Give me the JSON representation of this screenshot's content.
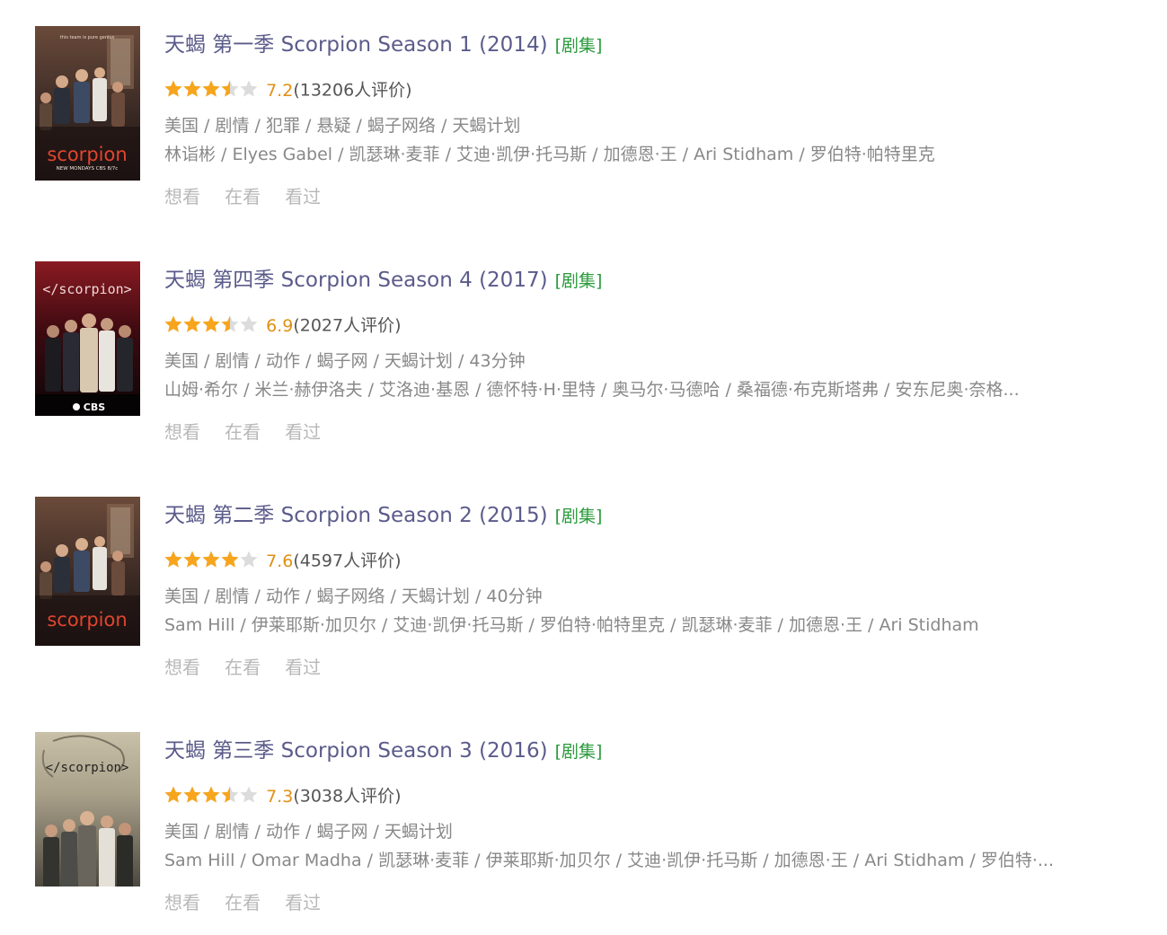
{
  "colors": {
    "title": "#5b5b8b",
    "tag": "#2a9a3b",
    "score": "#e09015",
    "star_on": "#f7a51c",
    "star_off": "#dcdcdc",
    "meta_text": "#888888",
    "action_text": "#b8b8b8"
  },
  "items": [
    {
      "title": "天蝎 第一季 Scorpion Season 1 (2014)",
      "tag": "[剧集]",
      "stars": 3.5,
      "score": "7.2",
      "rating_count": "(13206人评价)",
      "meta": "美国 / 剧情 / 犯罪 / 悬疑 / 蝎子网络 / 天蝎计划",
      "cast": "林诣彬 / Elyes Gabel / 凯瑟琳·麦菲 / 艾迪·凯伊·托马斯 / 加德恩·王 / Ari Stidham / 罗伯特·帕特里克",
      "actions": [
        "想看",
        "在看",
        "看过"
      ],
      "poster": {
        "wordmark": "scorpion",
        "tagline": "this team is pure genius",
        "footer": "NEW MONDAYS CBS 8/7c"
      }
    },
    {
      "title": "天蝎 第四季 Scorpion Season 4 (2017)",
      "tag": "[剧集]",
      "stars": 3.5,
      "score": "6.9",
      "rating_count": "(2027人评价)",
      "meta": "美国 / 剧情 / 动作 / 蝎子网 / 天蝎计划 / 43分钟",
      "cast": "山姆·希尔 / 米兰·赫伊洛夫 / 艾洛迪·基恩 / 德怀特·H·里特 / 奥马尔·马德哈 / 桑福德·布克斯塔弗 / 安东尼奥·奈格...",
      "actions": [
        "想看",
        "在看",
        "看过"
      ],
      "poster": {
        "wordmark": "</scorpion>",
        "footer": "CBS"
      }
    },
    {
      "title": "天蝎 第二季 Scorpion Season 2 (2015)",
      "tag": "[剧集]",
      "stars": 4,
      "score": "7.6",
      "rating_count": "(4597人评价)",
      "meta": "美国 / 剧情 / 动作 / 蝎子网络 / 天蝎计划 / 40分钟",
      "cast": "Sam Hill / 伊莱耶斯·加贝尔 / 艾迪·凯伊·托马斯 / 罗伯特·帕特里克 / 凯瑟琳·麦菲 / 加德恩·王 / Ari Stidham",
      "actions": [
        "想看",
        "在看",
        "看过"
      ],
      "poster": {
        "wordmark": "scorpion"
      }
    },
    {
      "title": "天蝎 第三季 Scorpion Season 3 (2016)",
      "tag": "[剧集]",
      "stars": 3.5,
      "score": "7.3",
      "rating_count": "(3038人评价)",
      "meta": "美国 / 剧情 / 动作 / 蝎子网 / 天蝎计划",
      "cast": "Sam Hill / Omar Madha / 凯瑟琳·麦菲 / 伊莱耶斯·加贝尔 / 艾迪·凯伊·托马斯 / 加德恩·王 / Ari Stidham / 罗伯特·...",
      "actions": [
        "想看",
        "在看",
        "看过"
      ],
      "poster": {
        "wordmark": "</scorpion>"
      }
    }
  ]
}
